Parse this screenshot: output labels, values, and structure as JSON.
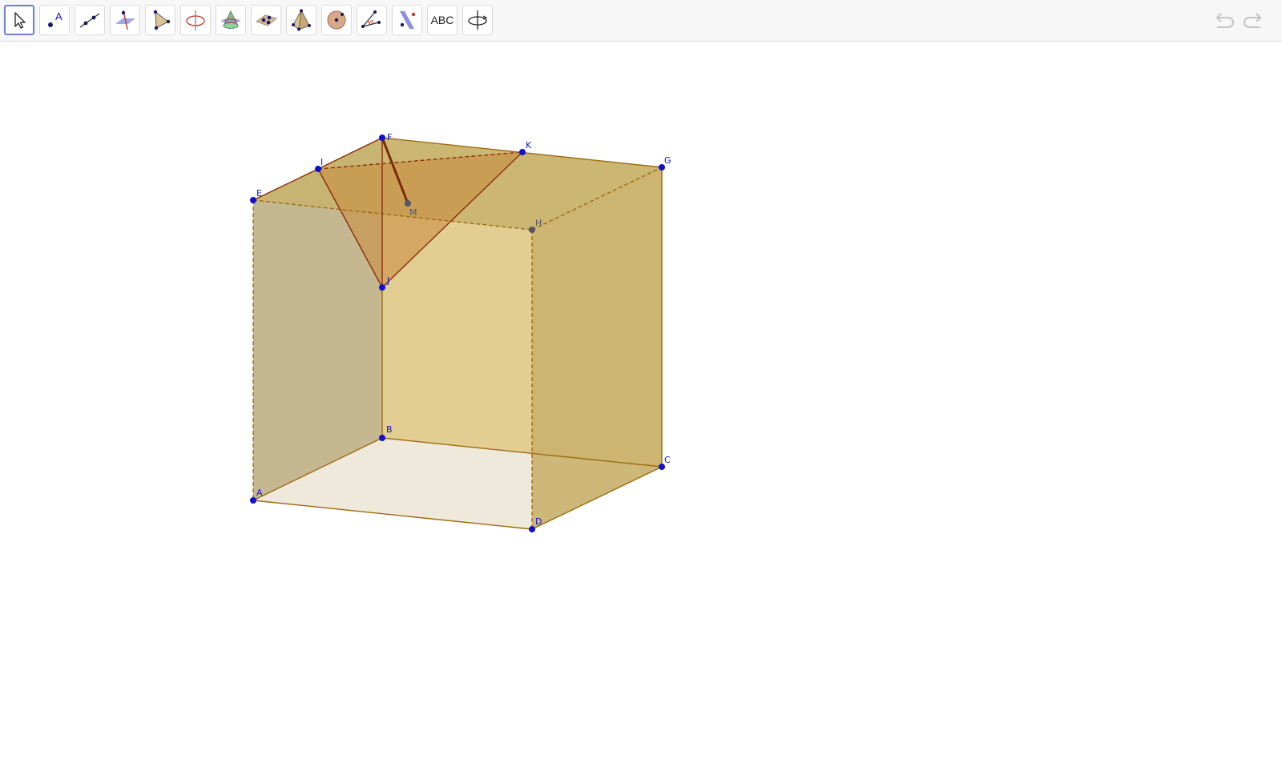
{
  "app": {
    "name": "GeoGebra 3D Graphics"
  },
  "toolbar": {
    "tools": [
      {
        "name": "move-tool",
        "icon": "arrow-cursor-icon",
        "selected": true
      },
      {
        "name": "point-tool",
        "icon": "point-icon",
        "label": "A"
      },
      {
        "name": "line-tool",
        "icon": "line-icon"
      },
      {
        "name": "perpendicular-tool",
        "icon": "perpendicular-line-icon"
      },
      {
        "name": "polygon-tool",
        "icon": "polygon-icon"
      },
      {
        "name": "circle-axis-tool",
        "icon": "circle-around-axis-icon"
      },
      {
        "name": "intersect-surfaces-tool",
        "icon": "intersect-surfaces-icon"
      },
      {
        "name": "plane-tool",
        "icon": "plane-through-points-icon"
      },
      {
        "name": "pyramid-tool",
        "icon": "pyramid-icon"
      },
      {
        "name": "sphere-tool",
        "icon": "sphere-icon"
      },
      {
        "name": "angle-tool",
        "icon": "angle-icon"
      },
      {
        "name": "reflect-tool",
        "icon": "reflect-about-plane-icon"
      },
      {
        "name": "text-tool",
        "icon": "text-icon",
        "label": "ABC"
      },
      {
        "name": "rotate-view-tool",
        "icon": "rotate-3d-view-icon"
      }
    ],
    "undo_icon": "undo-icon",
    "redo_icon": "redo-icon"
  },
  "scene": {
    "points": {
      "A": "A",
      "B": "B",
      "C": "C",
      "D": "D",
      "E": "E",
      "F": "F",
      "G": "G",
      "H": "H",
      "I": "I",
      "J": "J",
      "K": "K",
      "M": "M"
    },
    "colors": {
      "point": "#1010d0",
      "hidden_point": "#555566",
      "edge": "#a06a10",
      "section_edge": "#8b2d0a",
      "face_left": "#c5b891",
      "face_front": "#e2cd93",
      "face_right": "#c9b26e",
      "face_top": "#c7b26c",
      "face_bottom": "#efe9dc",
      "section_fill": "#c88a3c"
    }
  }
}
